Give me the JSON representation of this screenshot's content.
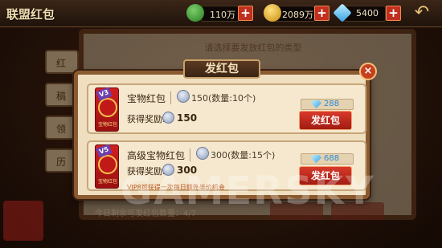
{
  "topbar": {
    "title": "联盟红包",
    "resources": [
      {
        "name": "money-bag",
        "value": "110万",
        "icon": "money-bag-icon"
      },
      {
        "name": "gold",
        "value": "2089万",
        "icon": "gold-coin-icon"
      },
      {
        "name": "diamond",
        "value": "5400",
        "icon": "diamond-icon"
      }
    ],
    "plus": "+",
    "back": "↶"
  },
  "background": {
    "hint": "请选择要发放红包的类型",
    "side_tabs": [
      "红",
      "稿",
      "领",
      "历"
    ],
    "bottom_note": "今日剩余可发红包数量：4/7"
  },
  "modal": {
    "title": "发红包",
    "close": "×",
    "rows": [
      {
        "level": "V3",
        "name": "宝物红包",
        "cost": "150(数量:10个)",
        "reward_label": "获得奖励:",
        "reward": "150",
        "price": "288",
        "button": "发红包",
        "envelope_label": "宝物红包",
        "note": ""
      },
      {
        "level": "V5",
        "name": "高级宝物红包",
        "cost": "300(数量:15个)",
        "reward_label": "获得奖励:",
        "reward": "300",
        "price": "688",
        "button": "发红包",
        "envelope_label": "宝物红包",
        "note": "VIP8可获得一次每日额外半价机会"
      }
    ]
  },
  "watermark": "GAMERSKY"
}
